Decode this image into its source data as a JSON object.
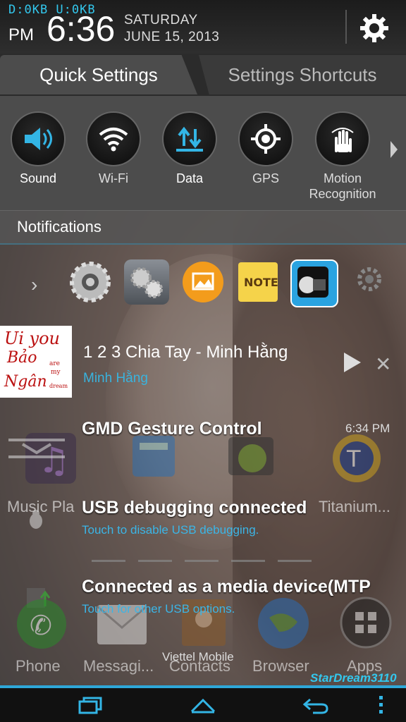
{
  "status_bar": {
    "net_stats": "D:0KB  U:0KB",
    "ampm": "PM",
    "time": "6:36",
    "day": "SATURDAY",
    "date": "JUNE 15, 2013",
    "settings_icon": "gear-icon"
  },
  "tabs": [
    {
      "label": "Quick Settings",
      "active": true
    },
    {
      "label": "Settings Shortcuts",
      "active": false
    }
  ],
  "quick_settings": [
    {
      "label": "Sound",
      "icon": "speaker-icon",
      "state": "on"
    },
    {
      "label": "Wi-Fi",
      "icon": "wifi-icon",
      "state": "off"
    },
    {
      "label": "Data",
      "icon": "data-transfer-icon",
      "state": "on"
    },
    {
      "label": "GPS",
      "icon": "gps-icon",
      "state": "off"
    },
    {
      "label": "Motion Recognition",
      "icon": "motion-hand-icon",
      "state": "off"
    }
  ],
  "notifications_header": "Notifications",
  "app_switcher": [
    {
      "icon": "settings-app-icon"
    },
    {
      "icon": "system-settings-icon"
    },
    {
      "icon": "gallery-icon"
    },
    {
      "icon": "note-icon"
    },
    {
      "icon": "flashlight-icon"
    },
    {
      "icon": "more-settings-icon"
    }
  ],
  "music": {
    "title": "1 2 3 Chia Tay - Minh Hằng",
    "artist": "Minh Hằng",
    "album_art_lines": [
      "Ui you",
      "Bảo",
      "are",
      "my",
      "Ngân",
      "dream"
    ]
  },
  "notifications": [
    {
      "title": "GMD Gesture Control",
      "subtitle": "",
      "time": "6:34 PM"
    },
    {
      "title": "USB debugging connected",
      "subtitle": "Touch to disable USB debugging."
    },
    {
      "title": "Connected as a media device(MTP",
      "subtitle": "Touch for other USB options."
    }
  ],
  "background_labels": {
    "music_player": "Music Pla",
    "titanium": "Titanium...",
    "phone": "Phone",
    "messaging": "Messagi...",
    "contacts": "Contacts",
    "browser": "Browser",
    "apps": "Apps"
  },
  "carrier": "Viettel Mobile",
  "watermark": "StarDream3110",
  "colors": {
    "accent": "#2ea7d8",
    "panel": "#4c4c4c"
  }
}
